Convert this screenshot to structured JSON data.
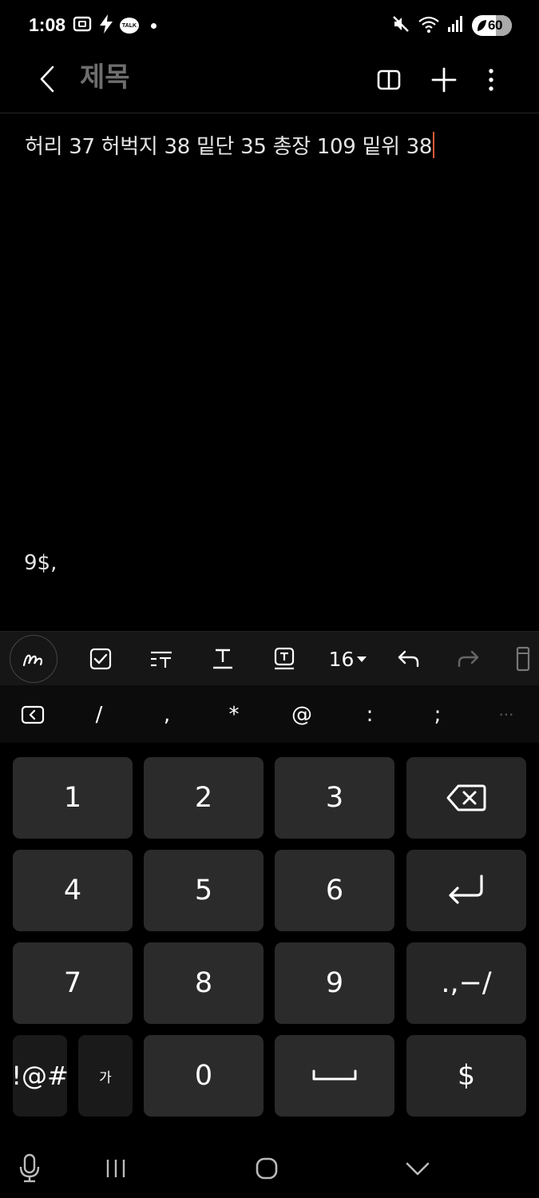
{
  "status_bar": {
    "time": "1:08",
    "talk_badge": "TALK",
    "battery_level": "60",
    "battery_fraction": 0.6,
    "icons_left": [
      "screenshot-icon",
      "charging-bolt-icon",
      "kakaotalk-icon",
      "notification-dot-icon"
    ],
    "icons_right": [
      "mute-icon",
      "wifi-icon",
      "signal-icon",
      "battery-icon"
    ]
  },
  "app_bar": {
    "title_placeholder": "제목",
    "actions": [
      "reading-mode-icon",
      "add-icon",
      "more-options-icon"
    ]
  },
  "note": {
    "body_text": "허리 37 허벅지 38 밑단 35 총장 109 밑위 38"
  },
  "keyboard_suggestion": "9$,",
  "format_toolbar": {
    "font_size": "16",
    "tools": [
      "handwriting-pen-icon",
      "checkbox-icon",
      "text-style-icon",
      "text-underline-icon",
      "text-box-icon",
      "font-size-dropdown",
      "undo-icon",
      "redo-icon",
      "more-tools-icon"
    ]
  },
  "symbol_strip": {
    "symbols": [
      "/",
      ",",
      "*",
      "@",
      ":",
      ";",
      "···"
    ]
  },
  "keypad": {
    "rows": [
      [
        "1",
        "2",
        "3"
      ],
      [
        "4",
        "5",
        "6"
      ],
      [
        "7",
        "8",
        "9"
      ]
    ],
    "punct_key": ".,−/",
    "symbols_key": "!@#",
    "lang_key": "가",
    "zero_key": "0",
    "dollar_key": "$"
  },
  "colors": {
    "background": "#000000",
    "key": "#2b2b2b",
    "caret": "#e05a3a",
    "title_placeholder": "#6e6e6e"
  }
}
